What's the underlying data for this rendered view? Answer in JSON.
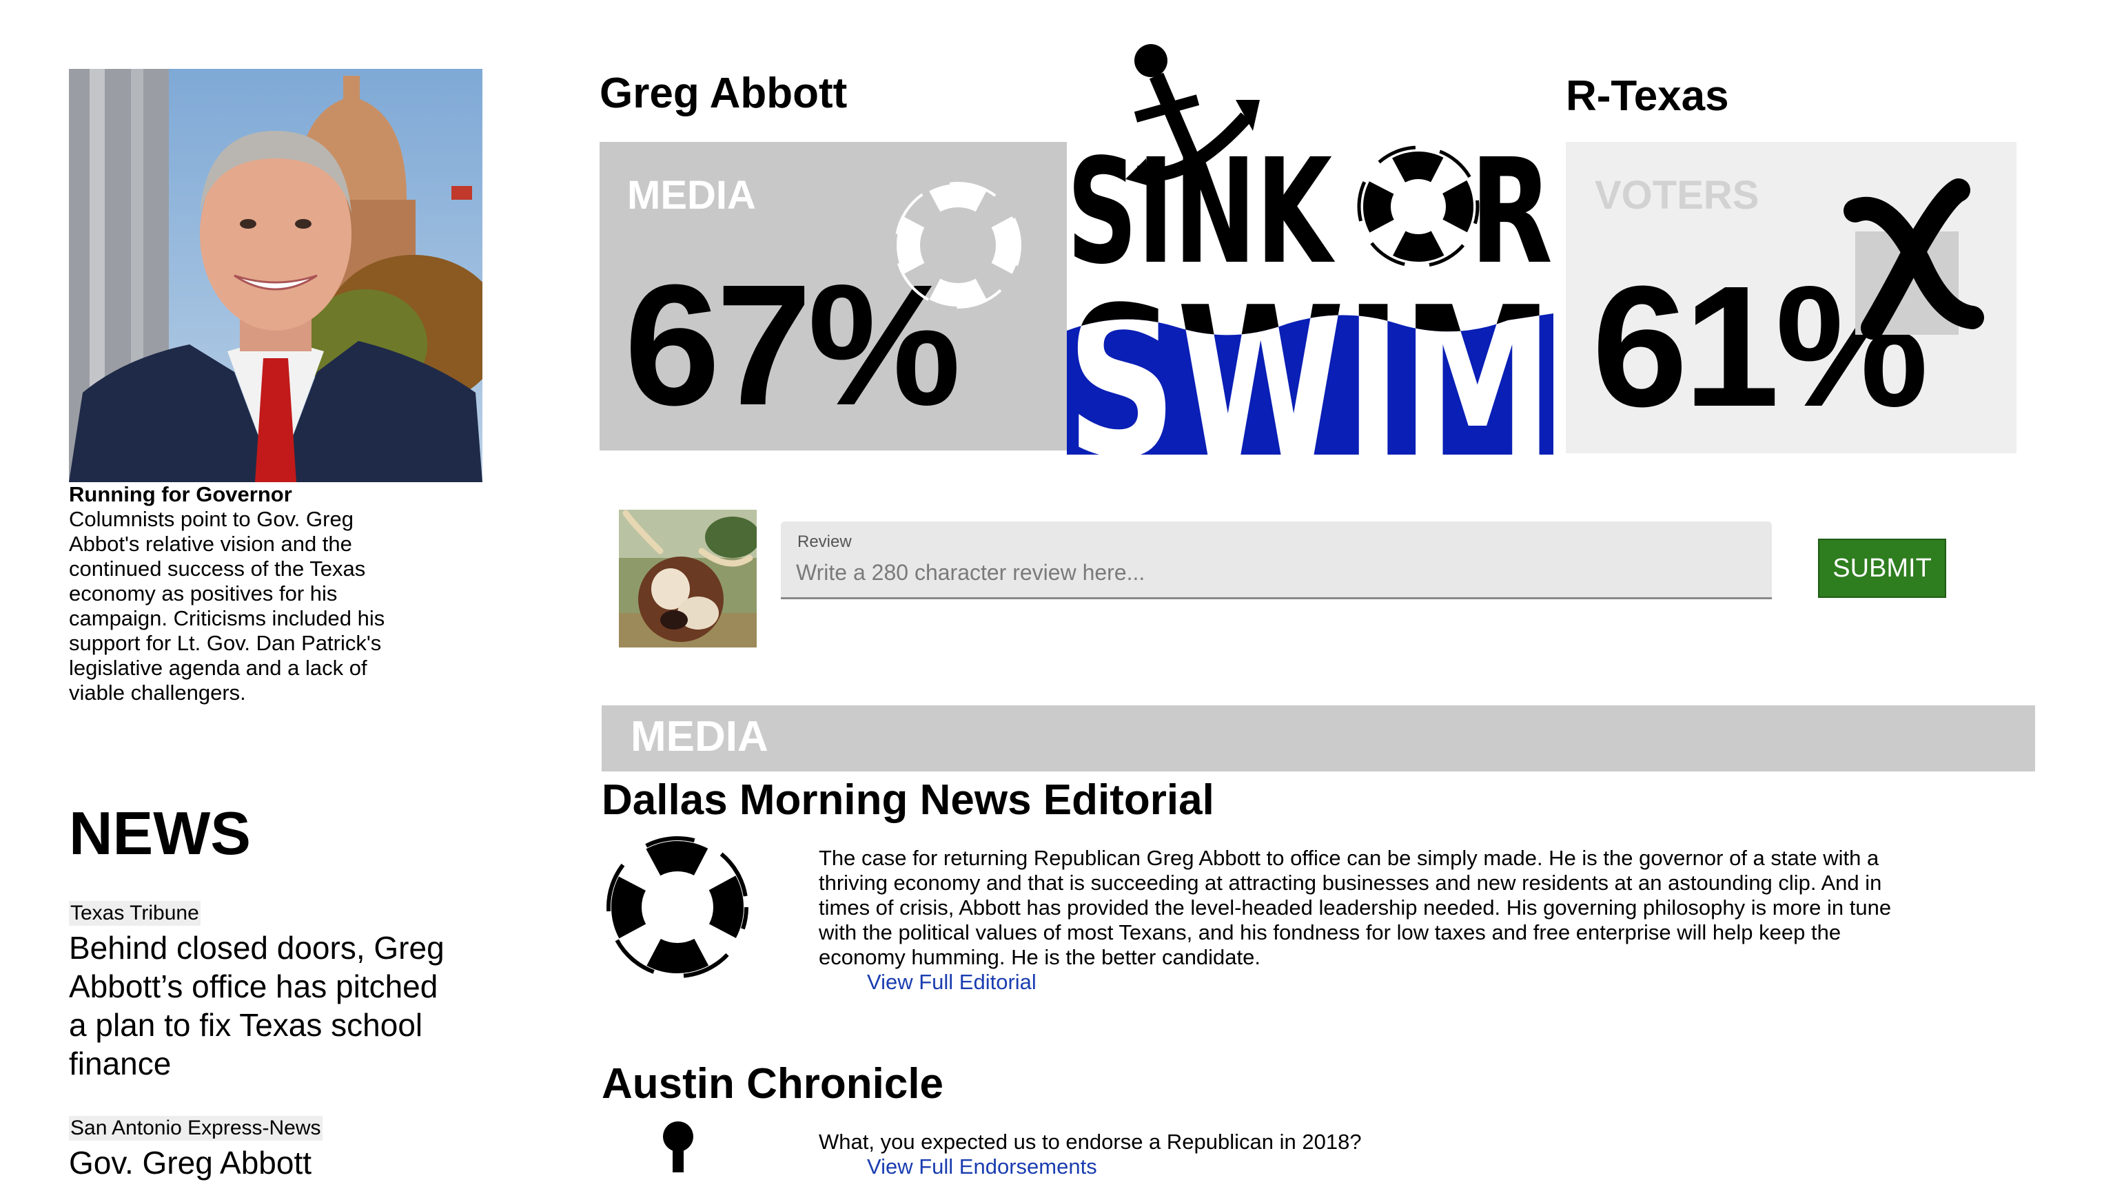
{
  "candidate": {
    "name": "Greg Abbott",
    "party": "R-Texas"
  },
  "profile": {
    "caption_title": "Running for Governor",
    "caption_text": "Columnists point to Gov. Greg Abbot's relative vision and the continued success of the Texas economy as positives for his campaign. Criticisms included his support for Lt. Gov. Dan Patrick's legislative agenda and a lack of viable challengers."
  },
  "scores": {
    "media": {
      "label": "MEDIA",
      "value": "67%",
      "icon": "life-ring-icon"
    },
    "voters": {
      "label": "VOTERS",
      "value": "61%",
      "icon": "x-mark-icon"
    }
  },
  "logo": {
    "top": "SINK OR",
    "bottom": "SWIM",
    "icons": [
      "anchor-icon",
      "life-ring-icon"
    ]
  },
  "review": {
    "label": "Review",
    "placeholder": "Write a 280 character review here...",
    "submit_label": "SUBMIT"
  },
  "news": {
    "heading": "NEWS",
    "items": [
      {
        "source": "Texas Tribune",
        "headline": "Behind closed doors, Greg Abbott’s office has pitched a plan to fix Texas school finance"
      },
      {
        "source": "San Antonio Express-News",
        "headline": "Gov. Greg Abbott"
      }
    ]
  },
  "media_section": {
    "heading": "MEDIA",
    "items": [
      {
        "title": "Dallas Morning News Editorial",
        "text": "The case for returning Republican Greg Abbott to office can be simply made. He is the governor of a state with a thriving economy and that is succeeding at attracting businesses and new residents at an astounding clip. And in times of crisis, Abbott has provided the level-headed leadership needed. His governing philosophy is more in tune with the political values of most Texans, and his fondness for low taxes and free enterprise will help keep the economy humming. He is the better candidate.",
        "link": "View Full Editorial",
        "icon": "life-ring-icon"
      },
      {
        "title": "Austin Chronicle",
        "text": "What, you expected us to endorse a Republican in 2018?",
        "link": "View Full Endorsements",
        "icon": "anchor-icon"
      }
    ]
  },
  "colors": {
    "swim_blue": "#0a1fb5",
    "submit_green": "#2e7d1f",
    "panel_gray": "#c8c8c8",
    "panel_light": "#efefef",
    "link_blue": "#1a3db0"
  }
}
